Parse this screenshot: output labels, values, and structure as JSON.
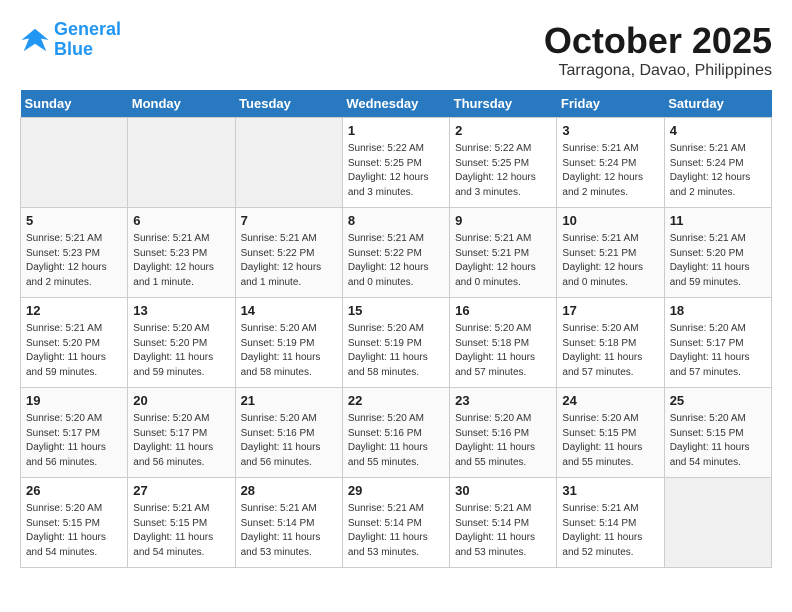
{
  "header": {
    "logo_line1": "General",
    "logo_line2": "Blue",
    "month": "October 2025",
    "location": "Tarragona, Davao, Philippines"
  },
  "weekdays": [
    "Sunday",
    "Monday",
    "Tuesday",
    "Wednesday",
    "Thursday",
    "Friday",
    "Saturday"
  ],
  "weeks": [
    [
      {
        "day": "",
        "empty": true
      },
      {
        "day": "",
        "empty": true
      },
      {
        "day": "",
        "empty": true
      },
      {
        "day": "1",
        "sunrise": "5:22 AM",
        "sunset": "5:25 PM",
        "daylight": "12 hours and 3 minutes."
      },
      {
        "day": "2",
        "sunrise": "5:22 AM",
        "sunset": "5:25 PM",
        "daylight": "12 hours and 3 minutes."
      },
      {
        "day": "3",
        "sunrise": "5:21 AM",
        "sunset": "5:24 PM",
        "daylight": "12 hours and 2 minutes."
      },
      {
        "day": "4",
        "sunrise": "5:21 AM",
        "sunset": "5:24 PM",
        "daylight": "12 hours and 2 minutes."
      }
    ],
    [
      {
        "day": "5",
        "sunrise": "5:21 AM",
        "sunset": "5:23 PM",
        "daylight": "12 hours and 2 minutes."
      },
      {
        "day": "6",
        "sunrise": "5:21 AM",
        "sunset": "5:23 PM",
        "daylight": "12 hours and 1 minute."
      },
      {
        "day": "7",
        "sunrise": "5:21 AM",
        "sunset": "5:22 PM",
        "daylight": "12 hours and 1 minute."
      },
      {
        "day": "8",
        "sunrise": "5:21 AM",
        "sunset": "5:22 PM",
        "daylight": "12 hours and 0 minutes."
      },
      {
        "day": "9",
        "sunrise": "5:21 AM",
        "sunset": "5:21 PM",
        "daylight": "12 hours and 0 minutes."
      },
      {
        "day": "10",
        "sunrise": "5:21 AM",
        "sunset": "5:21 PM",
        "daylight": "12 hours and 0 minutes."
      },
      {
        "day": "11",
        "sunrise": "5:21 AM",
        "sunset": "5:20 PM",
        "daylight": "11 hours and 59 minutes."
      }
    ],
    [
      {
        "day": "12",
        "sunrise": "5:21 AM",
        "sunset": "5:20 PM",
        "daylight": "11 hours and 59 minutes."
      },
      {
        "day": "13",
        "sunrise": "5:20 AM",
        "sunset": "5:20 PM",
        "daylight": "11 hours and 59 minutes."
      },
      {
        "day": "14",
        "sunrise": "5:20 AM",
        "sunset": "5:19 PM",
        "daylight": "11 hours and 58 minutes."
      },
      {
        "day": "15",
        "sunrise": "5:20 AM",
        "sunset": "5:19 PM",
        "daylight": "11 hours and 58 minutes."
      },
      {
        "day": "16",
        "sunrise": "5:20 AM",
        "sunset": "5:18 PM",
        "daylight": "11 hours and 57 minutes."
      },
      {
        "day": "17",
        "sunrise": "5:20 AM",
        "sunset": "5:18 PM",
        "daylight": "11 hours and 57 minutes."
      },
      {
        "day": "18",
        "sunrise": "5:20 AM",
        "sunset": "5:17 PM",
        "daylight": "11 hours and 57 minutes."
      }
    ],
    [
      {
        "day": "19",
        "sunrise": "5:20 AM",
        "sunset": "5:17 PM",
        "daylight": "11 hours and 56 minutes."
      },
      {
        "day": "20",
        "sunrise": "5:20 AM",
        "sunset": "5:17 PM",
        "daylight": "11 hours and 56 minutes."
      },
      {
        "day": "21",
        "sunrise": "5:20 AM",
        "sunset": "5:16 PM",
        "daylight": "11 hours and 56 minutes."
      },
      {
        "day": "22",
        "sunrise": "5:20 AM",
        "sunset": "5:16 PM",
        "daylight": "11 hours and 55 minutes."
      },
      {
        "day": "23",
        "sunrise": "5:20 AM",
        "sunset": "5:16 PM",
        "daylight": "11 hours and 55 minutes."
      },
      {
        "day": "24",
        "sunrise": "5:20 AM",
        "sunset": "5:15 PM",
        "daylight": "11 hours and 55 minutes."
      },
      {
        "day": "25",
        "sunrise": "5:20 AM",
        "sunset": "5:15 PM",
        "daylight": "11 hours and 54 minutes."
      }
    ],
    [
      {
        "day": "26",
        "sunrise": "5:20 AM",
        "sunset": "5:15 PM",
        "daylight": "11 hours and 54 minutes."
      },
      {
        "day": "27",
        "sunrise": "5:21 AM",
        "sunset": "5:15 PM",
        "daylight": "11 hours and 54 minutes."
      },
      {
        "day": "28",
        "sunrise": "5:21 AM",
        "sunset": "5:14 PM",
        "daylight": "11 hours and 53 minutes."
      },
      {
        "day": "29",
        "sunrise": "5:21 AM",
        "sunset": "5:14 PM",
        "daylight": "11 hours and 53 minutes."
      },
      {
        "day": "30",
        "sunrise": "5:21 AM",
        "sunset": "5:14 PM",
        "daylight": "11 hours and 53 minutes."
      },
      {
        "day": "31",
        "sunrise": "5:21 AM",
        "sunset": "5:14 PM",
        "daylight": "11 hours and 52 minutes."
      },
      {
        "day": "",
        "empty": true
      }
    ]
  ]
}
